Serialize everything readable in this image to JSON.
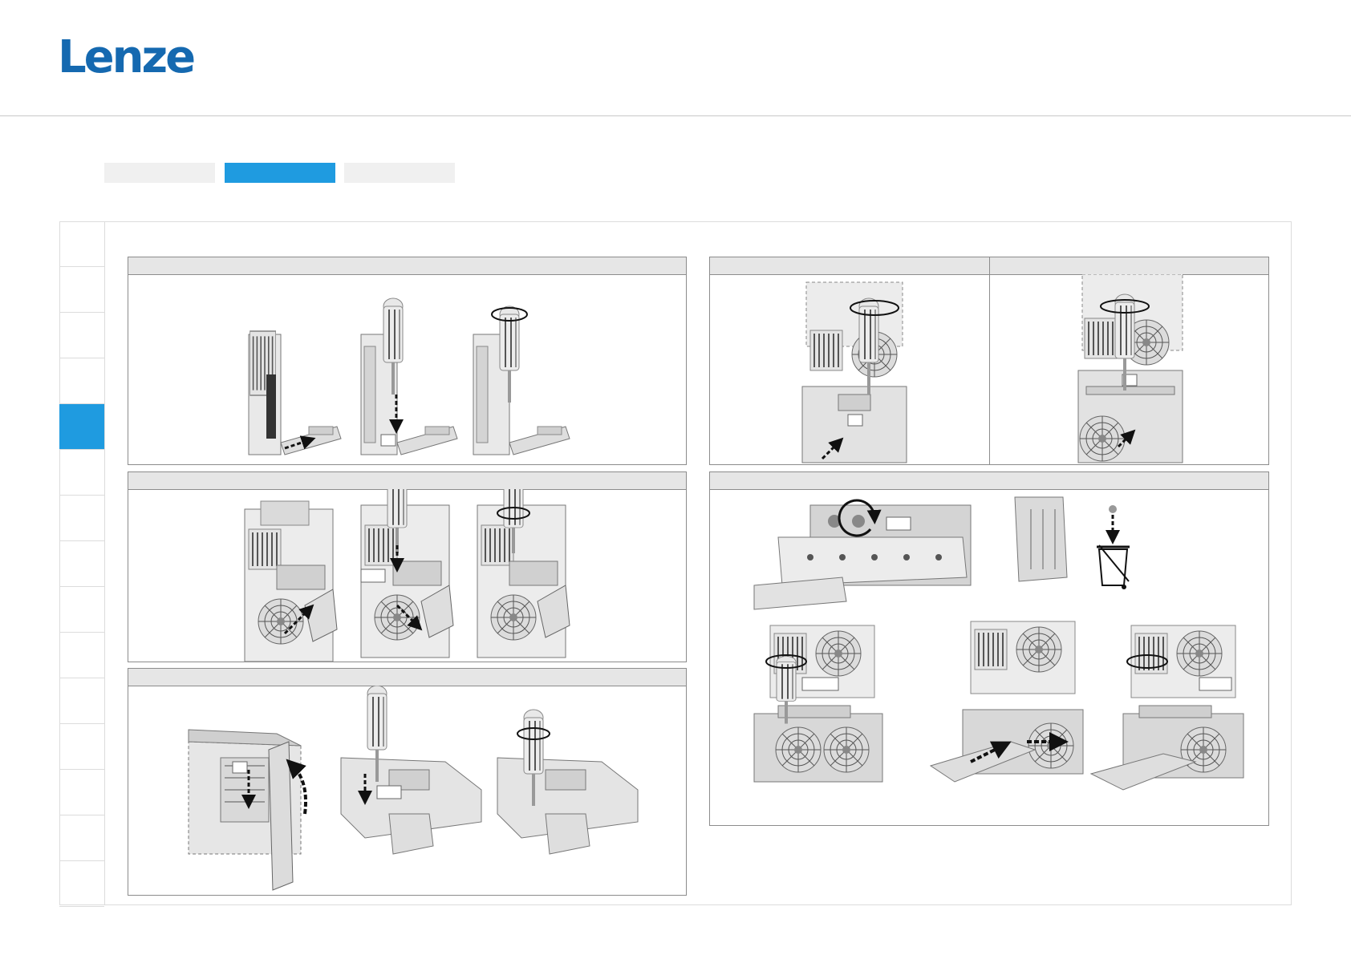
{
  "brand": {
    "logo_text": "Lenze",
    "logo_color": "#1569b0"
  },
  "tabs": [
    {
      "label": "",
      "active": false
    },
    {
      "label": "",
      "active": true
    },
    {
      "label": "",
      "active": false
    }
  ],
  "side_nav": {
    "item_count": 15,
    "active_index": 4
  },
  "colors": {
    "accent": "#1f9be0",
    "panel_header": "#e6e6e6",
    "border": "#8c8c8c"
  },
  "panels": [
    {
      "id": "top-left",
      "title": ""
    },
    {
      "id": "mid-left",
      "title": ""
    },
    {
      "id": "bottom-left",
      "title": ""
    },
    {
      "id": "top-right",
      "title_left": "",
      "title_right": ""
    },
    {
      "id": "bottom-right",
      "title": ""
    }
  ],
  "icons": [
    "screwdriver-icon",
    "rotate-arrow-icon",
    "dashed-arrow-icon",
    "trash-bin-icon",
    "fan-icon"
  ]
}
